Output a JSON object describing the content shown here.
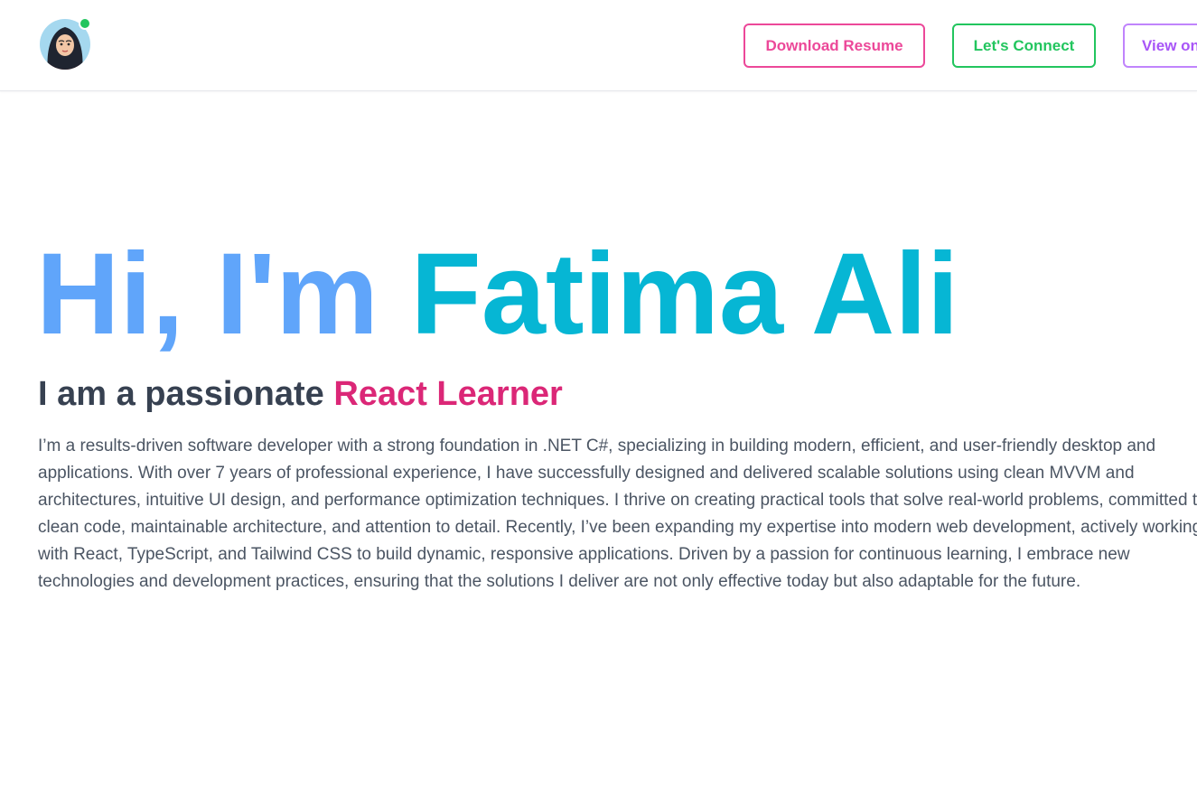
{
  "colors": {
    "resume": "#ec4899",
    "connect": "#22c55e",
    "view": "#a855f7",
    "greeting": "#60a5fa",
    "name": "#06b6d4",
    "role": "#db2777",
    "subtitle": "#374151",
    "body_text": "#4b5563",
    "status_online": "#22c55e"
  },
  "header": {
    "avatar_icon": "woman-hijab-avatar-icon",
    "buttons": {
      "resume_label": "Download Resume",
      "connect_label": "Let's Connect",
      "view_label": "View on"
    }
  },
  "hero": {
    "greeting": "Hi, I'm",
    "name": "Fatima Ali",
    "subtitle_prefix": "I am a passionate",
    "role": "React Learner",
    "bio_lines": [
      "I’m a results-driven software developer with a strong foundation in .NET C#, specializing in building modern, efficient, and user-friendly desktop and",
      "applications. With over 7 years of professional experience, I have successfully designed and delivered scalable solutions using clean MVVM and",
      "architectures, intuitive UI design, and performance optimization techniques. I thrive on creating practical tools that solve real-world problems, committed to",
      "clean code, maintainable architecture, and attention to detail. Recently, I’ve been expanding my expertise into modern web development, actively working",
      "with React, TypeScript, and Tailwind CSS to build dynamic, responsive applications. Driven by a passion for continuous learning, I embrace new",
      "technologies and development practices, ensuring that the solutions I deliver are not only effective today but also adaptable for the future."
    ]
  }
}
